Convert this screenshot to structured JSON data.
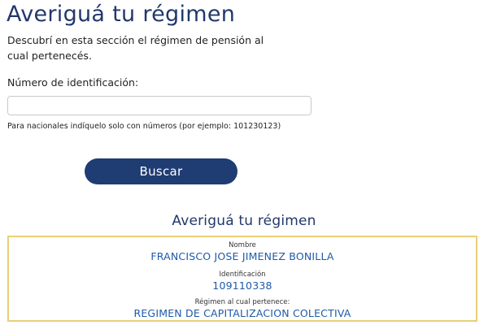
{
  "header": {
    "title": "Averiguá tu régimen"
  },
  "intro": {
    "text": "Descubrí en esta sección el régimen de pensión al cual pertenecés."
  },
  "form": {
    "id_label": "Número de identificación:",
    "id_value": "",
    "hint": "Para nacionales indíquelo solo con números (por ejemplo: 101230123)",
    "search_label": "Buscar"
  },
  "result": {
    "title": "Averiguá tu régimen",
    "name_label": "Nombre",
    "name_value": "FRANCISCO JOSE JIMENEZ BONILLA",
    "id_label": "Identificación",
    "id_value": "109110338",
    "regime_label": "Régimen al cual pertenece:",
    "regime_value": "REGIMEN DE CAPITALIZACION COLECTIVA"
  },
  "colors": {
    "brand_navy": "#1f3c73",
    "link_blue": "#1e5aa8",
    "card_border_gold": "#e8cf79"
  }
}
